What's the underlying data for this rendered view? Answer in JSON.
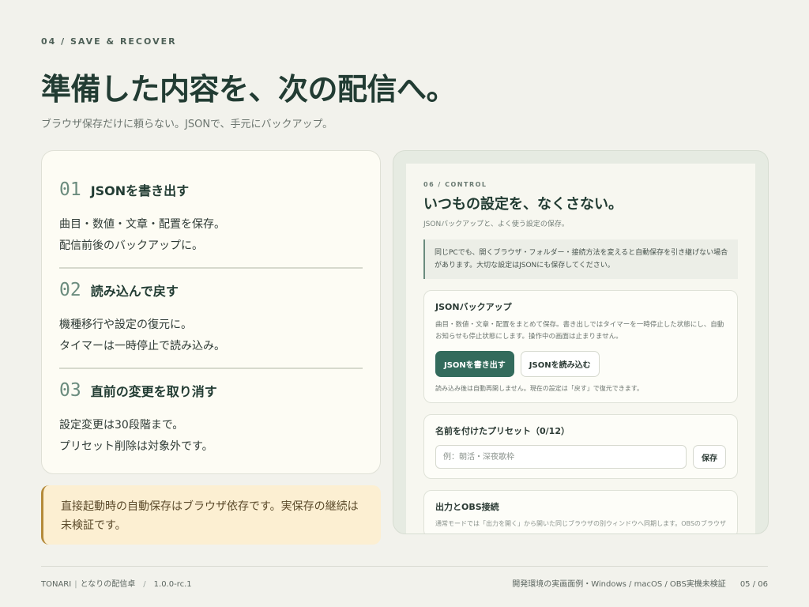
{
  "header": {
    "eyebrow": "04 / SAVE & RECOVER",
    "title": "準備した内容を、次の配信へ。",
    "subtitle": "ブラウザ保存だけに頼らない。JSONで、手元にバックアップ。"
  },
  "steps": [
    {
      "num": "01",
      "title": "JSONを書き出す",
      "line1": "曲目・数値・文章・配置を保存。",
      "line2": "配信前後のバックアップに。"
    },
    {
      "num": "02",
      "title": "読み込んで戻す",
      "line1": "機種移行や設定の復元に。",
      "line2": "タイマーは一時停止で読み込み。"
    },
    {
      "num": "03",
      "title": "直前の変更を取り消す",
      "line1": "設定変更は30段階まで。",
      "line2": "プリセット削除は対象外です。"
    }
  ],
  "note": "直接起動時の自動保存はブラウザ依存です。実保存の継続は未検証です。",
  "preview": {
    "eyebrow": "06 / CONTROL",
    "title": "いつもの設定を、なくさない。",
    "subtitle": "JSONバックアップと、よく使う設定の保存。",
    "alert": "同じPCでも、開くブラウザ・フォルダー・接続方法を変えると自動保存を引き継げない場合があります。大切な設定はJSONにも保存してください。",
    "backup": {
      "title": "JSONバックアップ",
      "desc": "曲目・数値・文章・配置をまとめて保存。書き出しではタイマーを一時停止した状態にし、自動お知らせも停止状態にします。操作中の画面は止まりません。",
      "export_label": "JSONを書き出す",
      "import_label": "JSONを読み込む",
      "foot": "読み込み後は自動再開しません。現在の設定は「戻す」で復元できます。"
    },
    "preset": {
      "title": "名前を付けたプリセット（0/12）",
      "placeholder": "例：朝活・深夜歌枠",
      "save_label": "保存"
    },
    "output": {
      "title": "出力とOBS接続",
      "desc": "通常モードでは「出力を開く」から開いた同じブラウザの別ウィンドウへ同期します。OBSのブラウザ"
    }
  },
  "footer": {
    "brand": "TONARI",
    "app": "となりの配信卓",
    "version": "1.0.0-rc.1",
    "env": "開発環境の実画面例・Windows / macOS / OBS実機未検証",
    "page": "05 / 06"
  }
}
